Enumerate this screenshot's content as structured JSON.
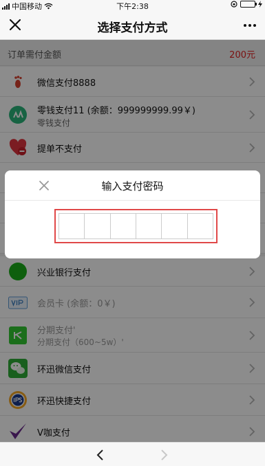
{
  "status_bar": {
    "carrier": "中国移动",
    "time": "下午2:38"
  },
  "nav": {
    "title": "选择支付方式"
  },
  "order": {
    "label": "订单需付金额",
    "amount": "200元"
  },
  "payment_methods": [
    {
      "title": "微信支付8888",
      "subtitle": "",
      "icon": "footprint-icon"
    },
    {
      "title": "零钱支付11 (余额：999999999.99￥)",
      "subtitle": "零钱支付",
      "icon": "wallet-icon"
    },
    {
      "title": "提单不支付",
      "subtitle": "",
      "icon": "heart-minus-icon"
    },
    {
      "title": "",
      "subtitle": "",
      "icon": "red-icon"
    },
    {
      "title": "",
      "subtitle": "",
      "icon": "blank-icon"
    },
    {
      "title": "",
      "subtitle": "",
      "icon": "blank-icon"
    },
    {
      "title": "兴业银行支付",
      "subtitle": "",
      "icon": "green-circle-icon"
    },
    {
      "title": "会员卡 (余额：0￥)",
      "subtitle": "",
      "icon": "vip-card-icon"
    },
    {
      "title": "分期支付'",
      "subtitle": "分期支付（600~5w）'",
      "icon": "installment-card-icon"
    },
    {
      "title": "环迅微信支付",
      "subtitle": "",
      "icon": "wechat-icon"
    },
    {
      "title": "环迅快捷支付",
      "subtitle": "",
      "icon": "ips-icon"
    },
    {
      "title": "V咖支付",
      "subtitle": "",
      "icon": "check-v-icon"
    }
  ],
  "modal": {
    "title": "输入支付密码"
  },
  "colors": {
    "accent_red": "#e02020",
    "highlight": "#e04848",
    "green": "#1aad19"
  }
}
